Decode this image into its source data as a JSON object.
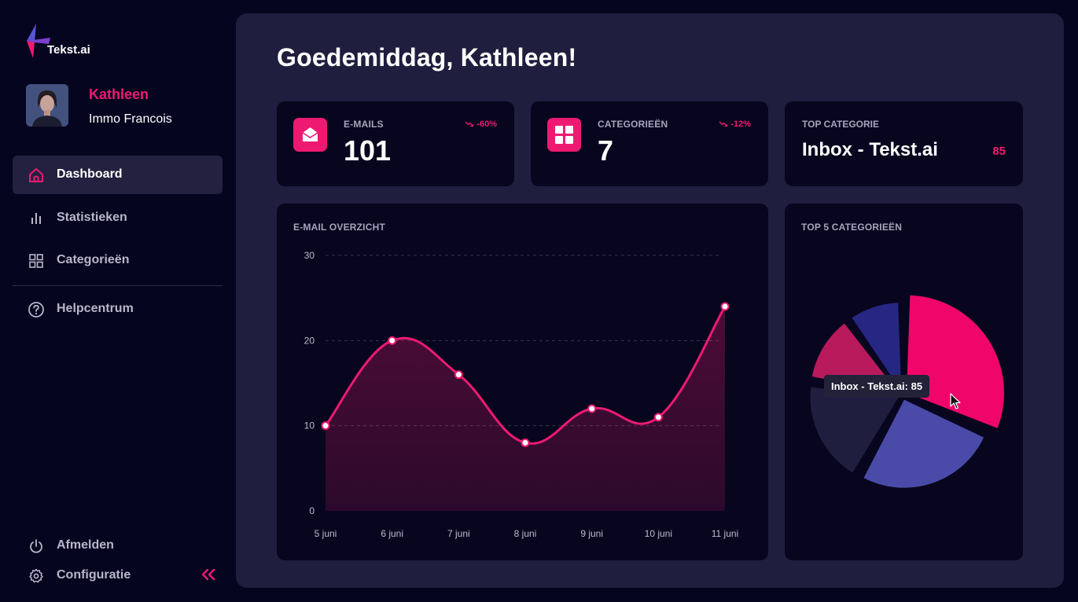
{
  "app": {
    "logo_text": "Tekst.ai"
  },
  "user": {
    "name": "Kathleen",
    "company": "Immo Francois"
  },
  "nav": {
    "dashboard": "Dashboard",
    "stats": "Statistieken",
    "categories": "Categorieën",
    "help": "Helpcentrum",
    "logout": "Afmelden",
    "config": "Configuratie"
  },
  "greeting": "Goedemiddag, Kathleen!",
  "stats": {
    "emails": {
      "label": "E-MAILS",
      "value": "101",
      "change": "-60%"
    },
    "categories": {
      "label": "CATEGORIEËN",
      "value": "7",
      "change": "-12%"
    },
    "top": {
      "label": "TOP CATEGORIE",
      "name": "Inbox - Tekst.ai",
      "count": "85"
    }
  },
  "colors": {
    "accent": "#ee1a72",
    "background": "#06051f",
    "panel": "#201e3e",
    "card": "#07061e"
  },
  "email_chart": {
    "title": "E-MAIL OVERZICHT",
    "chart_data": {
      "type": "area",
      "categories": [
        "5 juni",
        "6 juni",
        "7 juni",
        "8 juni",
        "9 juni",
        "10 juni",
        "11 juni"
      ],
      "values": [
        10,
        20,
        16,
        8,
        12,
        11,
        24
      ],
      "yticks": [
        0,
        10,
        20,
        30
      ],
      "ylim": [
        0,
        30
      ],
      "grid": true,
      "color": "#ee1a72"
    }
  },
  "pie_chart": {
    "title": "TOP 5 CATEGORIEËN",
    "tooltip": "Inbox - Tekst.ai: 85",
    "chart_data": {
      "type": "pie",
      "slices": [
        {
          "value": 85,
          "color": "#f0066a"
        },
        {
          "value": 72,
          "color": "#4a4aa8"
        },
        {
          "value": 52,
          "color": "#1f1e3e"
        },
        {
          "value": 34,
          "color": "#b81a5c"
        },
        {
          "value": 27,
          "color": "#262783"
        }
      ]
    }
  }
}
